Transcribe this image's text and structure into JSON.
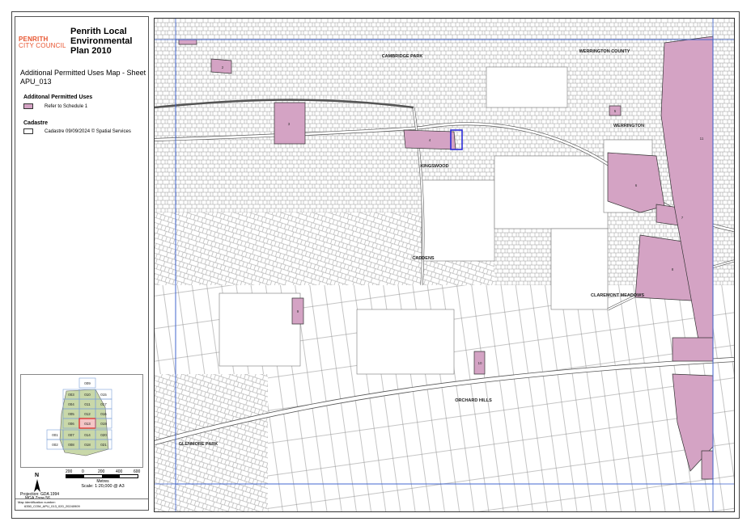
{
  "header": {
    "logo_line1": "PENRITH",
    "logo_line2": "CITY COUNCIL",
    "title": "Penrith Local Environmental Plan 2010",
    "subtitle": "Additional Permitted Uses Map - Sheet APU_013"
  },
  "legend": {
    "section1_title": "Additonal Permitted Uses",
    "item1_label": "Refer to Schedule 1",
    "section2_title": "Cadastre",
    "item2_label": "Cadastre 09/09/2024 © Spatial Services"
  },
  "keymap": {
    "sheets": [
      "009",
      "003",
      "010",
      "015",
      "004",
      "011",
      "017",
      "005",
      "012",
      "016",
      "006",
      "013",
      "019",
      "001",
      "007",
      "014",
      "020",
      "002",
      "008",
      "018",
      "021"
    ],
    "current": "013"
  },
  "scale": {
    "north": "N",
    "ticks": [
      "200",
      "0",
      "200",
      "400",
      "600"
    ],
    "unit": "Metres",
    "scale_text": "Scale: 1:20,000 @ A3",
    "projection": "Projection: GDA 1994",
    "zone": "MGA Zone 56"
  },
  "footer": {
    "label": "Map identification number:",
    "id": "6350_COM_APU_013_020_20240909"
  },
  "map": {
    "suburbs": [
      "CAMBRIDGE PARK",
      "WERRINGTON COUNTY",
      "WERRINGTON",
      "KINGSWOOD",
      "CADDENS",
      "CLAREMONT MEADOWS",
      "ORCHARD HILLS",
      "GLENMORE PARK"
    ],
    "parcel_labels": [
      "2",
      "3",
      "4",
      "5",
      "6",
      "7",
      "8",
      "9",
      "10",
      "11"
    ],
    "fill_color": "#d4a3c4",
    "boundary_color": "#3a5fcd"
  }
}
